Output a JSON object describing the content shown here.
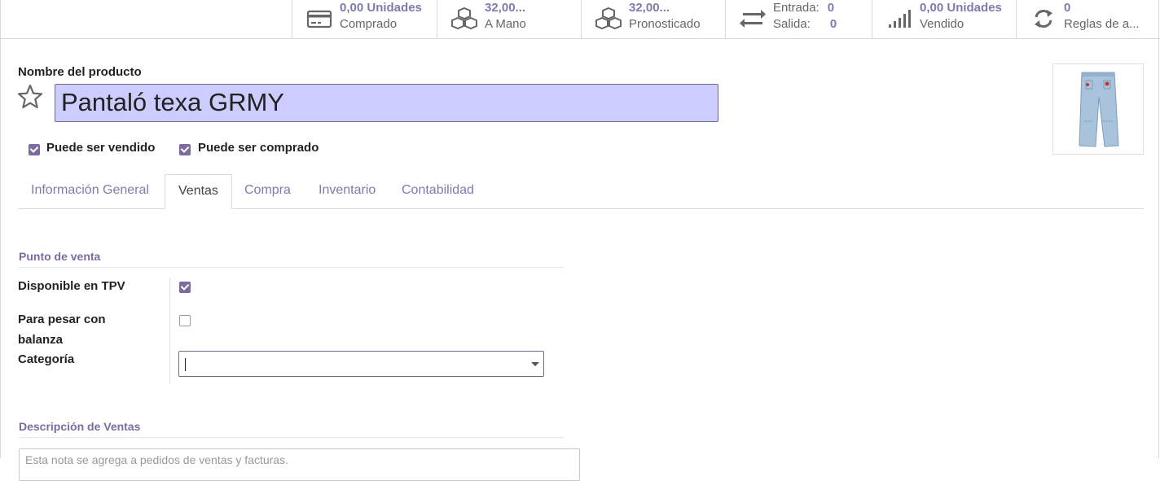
{
  "stats": [
    {
      "name": "purchased",
      "line1": "0,00 Unidades",
      "line2": "Comprado",
      "icon": "credit-card-icon"
    },
    {
      "name": "on-hand",
      "line1": "32,00...",
      "line2": "A Mano",
      "icon": "cubes-icon"
    },
    {
      "name": "forecasted",
      "line1": "32,00...",
      "line2": "Pronosticado",
      "icon": "cubes-icon"
    },
    {
      "name": "in-out",
      "in_label": "Entrada:",
      "in_value": "0",
      "out_label": "Salida:",
      "out_value": "0",
      "icon": "exchange-icon"
    },
    {
      "name": "sold",
      "line1": "0,00 Unidades",
      "line2": "Vendido",
      "icon": "signal-icon"
    },
    {
      "name": "reorder-rules",
      "line1": "0",
      "line2": "Reglas de a...",
      "icon": "refresh-icon"
    }
  ],
  "product": {
    "name_label": "Nombre del producto",
    "name": "Pantaló texa GRMY",
    "can_be_sold_label": "Puede ser vendido",
    "can_be_sold": true,
    "can_be_purchased_label": "Puede ser comprado",
    "can_be_purchased": true,
    "image": "jeans-product-image"
  },
  "tabs": [
    {
      "label": "Información General",
      "active": false
    },
    {
      "label": "Ventas",
      "active": true
    },
    {
      "label": "Compra",
      "active": false
    },
    {
      "label": "Inventario",
      "active": false
    },
    {
      "label": "Contabilidad",
      "active": false
    }
  ],
  "pos": {
    "section_title": "Punto de venta",
    "available_label": "Disponible en TPV",
    "available": true,
    "weigh_label_1": "Para pesar con",
    "weigh_label_2": "balanza",
    "weigh": false,
    "category_label": "Categoría",
    "category_value": ""
  },
  "sales_description": {
    "section_title": "Descripción de Ventas",
    "placeholder": "Esta nota se agrega a pedidos de ventas y facturas."
  },
  "colors": {
    "accent": "#7c6b9e",
    "link": "#7c7bad",
    "title_bg": "#ccccff"
  }
}
